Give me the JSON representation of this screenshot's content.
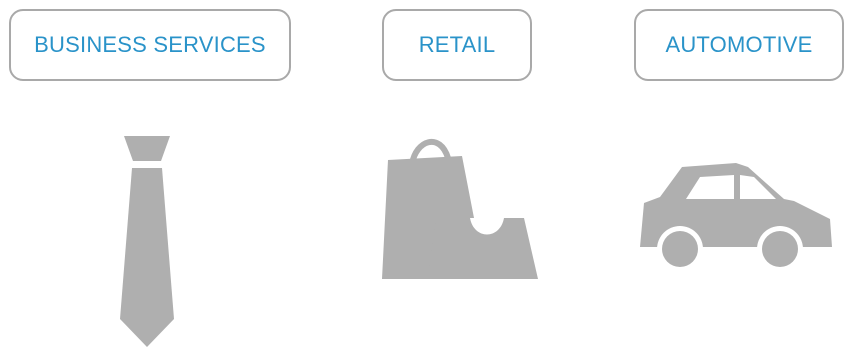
{
  "categories": [
    {
      "label": "BUSINESS SERVICES",
      "icon": "necktie-icon"
    },
    {
      "label": "RETAIL",
      "icon": "shopping-bags-icon"
    },
    {
      "label": "AUTOMOTIVE",
      "icon": "car-icon"
    }
  ],
  "colors": {
    "label_text": "#2a93c9",
    "pill_border": "#a9a9a9",
    "icon_fill": "#afafaf",
    "background": "#ffffff"
  }
}
